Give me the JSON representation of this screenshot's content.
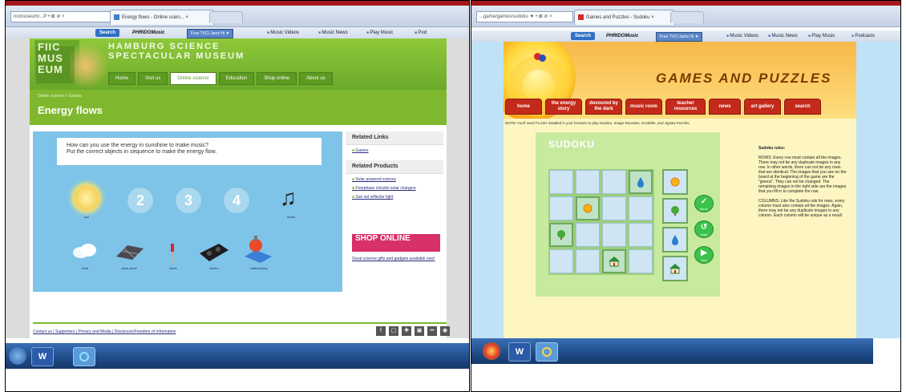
{
  "left": {
    "browser": {
      "address_fragment": "ncimuseum/...P • ⊠ ⊘ ×",
      "tab_title": "Energy flows - Online scien... ×",
      "toolbar": {
        "search_label": "Search",
        "logo": "PHRIDOMusic",
        "field": "Free TVCl Jams Hi ▼",
        "links": [
          "Music Videos",
          "Music News",
          "Play Music",
          "Pod"
        ]
      }
    },
    "site": {
      "logo_text": "FIIC MUS EUM",
      "title_line1": "HAMBURG SCIENCE",
      "title_line2": "SPECTACULAR MUSEUM",
      "nav": [
        "Home",
        "Visit us",
        "Online science",
        "Education",
        "Shop online",
        "About us"
      ],
      "nav_active_index": 2,
      "breadcrumb": "Online science > Games",
      "page_title": "Energy flows",
      "question_line1": "How can you use the energy in sunshine to make music?",
      "question_line2": "Put the correct objects in sequence to make the energy flow.",
      "sequence": [
        "2",
        "3",
        "4"
      ],
      "seq_captions": {
        "sun": "sun",
        "music": "music"
      },
      "objects": [
        "wind",
        "solar panel",
        "wires",
        "stereo",
        "battery/plug"
      ],
      "related_links_heading": "Related Links",
      "related_links": [
        "Games"
      ],
      "related_products_heading": "Related Products",
      "related_products": [
        "Solar powered science",
        "Freephase chiostin solar chargers",
        "Sun set reflector light"
      ],
      "shop_label": "SHOP ONLINE",
      "shop_link": "Great science gifts and gadgets available now!",
      "footer_links": "Contact us | Supporters | Privacy and Media | Disclosure/Freedom of Information",
      "social": [
        "f",
        "▢",
        "✚",
        "▣",
        "••",
        "◉"
      ]
    },
    "taskbar": {
      "word_label": "W"
    }
  },
  "right": {
    "browser": {
      "address_fragment": "...game/games/sudoku ▼ • ⊠ ⊘ ×",
      "tab_title": "Games and Puzzles - Sudoku ×",
      "toolbar": {
        "search_label": "Search",
        "logo": "PHRIDOMusic",
        "field": "Free TVCl Jams Hi ▼",
        "links": [
          "Music Videos",
          "Music News",
          "Play Music",
          "Podcasts"
        ]
      }
    },
    "site": {
      "title": "GAMES AND PUZZLES",
      "nav": [
        "home",
        "the energy story",
        "devoured by the dark",
        "music room",
        "teacher resources",
        "news",
        "art gallery",
        "search"
      ],
      "notice": "NOTE! You'll need FLASH installed in your browser to play Sudoku, Image Revealer, Scrabble, and Jigsaw Puzzles.",
      "game_title": "SUDOKU",
      "button_labels": [
        "done!",
        "reset",
        "next"
      ],
      "rules_title": "Sudoku rules:",
      "rules_rows": "ROWS: Every row must contain all the images. There may not be any duplicate images in any row. In other words, there can not be any rows that are identical. The images that you see on the board at the beginning of the game are the \"givens\". They can not be changed. The remaining images in the right side are the images that you fill in to complete the row.",
      "rules_columns": "COLUMNS: Like the Sudoku rule for rows, every column must also contain all the images. Again, there may not be any duplicate images in any column. Each column will be unique as a result."
    }
  },
  "colors": {
    "green_brand": "#7fb82e",
    "sky_stage": "#7ec4e8",
    "red_nav": "#c42a1a",
    "game_bg": "#c8ea9e"
  }
}
